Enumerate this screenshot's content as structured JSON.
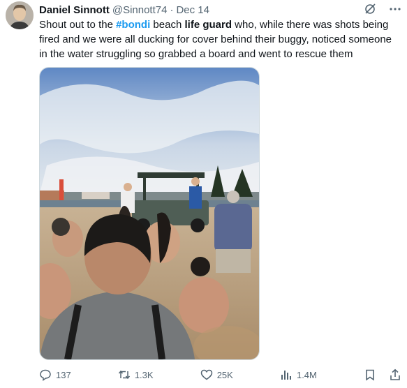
{
  "author": {
    "name": "Daniel Sinnott",
    "handle": "@Sinnott74",
    "separator": "·",
    "date": "Dec 14"
  },
  "tweet": {
    "t1": "Shout out to the ",
    "hashtag": "#bondi",
    "t2": " beach ",
    "bold": "life guard",
    "t3": " who, while there was shots being fired and we were all ducking for cover behind their buggy, noticed someone in the water struggling so grabbed a board and went to rescue them"
  },
  "actions": {
    "replies": "137",
    "reposts": "1.3K",
    "likes": "25K",
    "views": "1.4M"
  },
  "icons": {
    "grok": "grok-icon",
    "more": "more-icon",
    "reply": "reply-icon",
    "repost": "repost-icon",
    "like": "like-icon",
    "views": "views-icon",
    "bookmark": "bookmark-icon",
    "share": "share-icon"
  },
  "colors": {
    "accent": "#1d9bf0",
    "text": "#0f1419",
    "muted": "#536471"
  }
}
